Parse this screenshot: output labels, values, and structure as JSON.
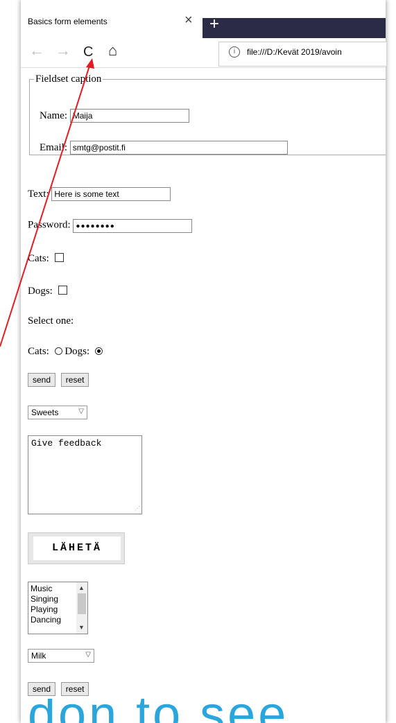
{
  "browser": {
    "tab_title": "Basics form elements",
    "tab_close": "×",
    "new_tab": "+",
    "back_icon": "←",
    "forward_icon": "→",
    "refresh_icon": "C",
    "home_icon": "⌂",
    "info_icon": "i",
    "url": "file:///D:/Kevät 2019/avoin"
  },
  "fieldset": {
    "legend": "Fieldset caption",
    "name_label": "Name:",
    "name_value": "Maija",
    "email_label": "Email:",
    "email_value": "smtg@postit.fi"
  },
  "form": {
    "text_label": "Text:",
    "text_value": "Here is some text",
    "password_label": "Password:",
    "password_value": "●●●●●●●●",
    "cats_label": "Cats:",
    "dogs_label": "Dogs:",
    "select_one_label": "Select one:",
    "radio_cats_label": "Cats:",
    "radio_dogs_label": "Dogs:",
    "send_label": "send",
    "reset_label": "reset",
    "dropdown_value": "Sweets",
    "feedback_text": "Give feedback",
    "laheta_label": "LÄHETÄ",
    "listbox_items": [
      "Music",
      "Singing",
      "Playing",
      "Dancing"
    ],
    "drink_value": "Milk",
    "send2_label": "send",
    "reset2_label": "reset"
  },
  "overlay_text": "don to see",
  "colors": {
    "arrow": "#e31b23",
    "overlay_text": "#2aa6dc",
    "tab_strip": "#2b2b45"
  }
}
